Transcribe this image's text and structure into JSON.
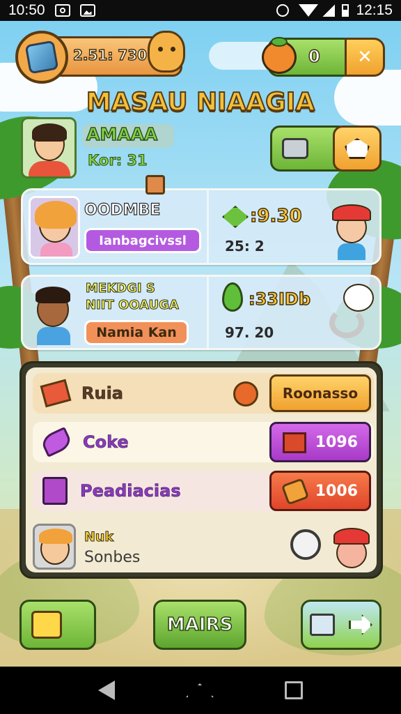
{
  "status_bar": {
    "left_time": "10:50",
    "right_time": "12:15"
  },
  "header": {
    "score": "2.51: 730",
    "currency": "0",
    "title": "MASAU NIAAGIA"
  },
  "profile": {
    "name": "AMAAA",
    "sub": "Kor: 31"
  },
  "card1": {
    "title": "OODMBE",
    "tag": "Ianbagcivssl",
    "value": ":9.30",
    "sub": "25: 2"
  },
  "card2": {
    "title_line1": "MEKDGI S",
    "title_line2": "NIIT OOAUGA",
    "tag": "Namia Kan",
    "value": ":33IDb",
    "sub": "97. 20"
  },
  "list": {
    "row1": {
      "label": "Ruia",
      "button": "Roonasso"
    },
    "row2": {
      "label": "Coke",
      "button": "1096"
    },
    "row3": {
      "label": "Peadiacias",
      "button": "1006"
    },
    "row4": {
      "label_top": "Nuk",
      "label_bottom": "Sonbes"
    }
  },
  "bottom": {
    "center_button": "MAIRS"
  },
  "colors": {
    "accent_green": "#8fd14f",
    "accent_orange": "#f7b234",
    "accent_purple": "#b34fd6",
    "accent_red": "#f25a3a",
    "panel_dark": "#3a3a2a"
  }
}
